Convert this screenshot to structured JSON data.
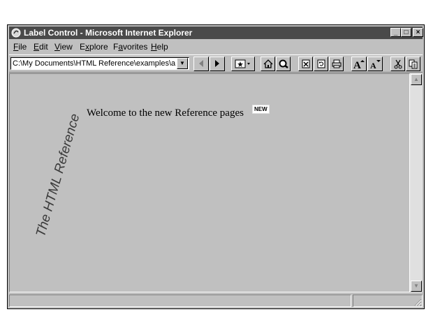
{
  "window": {
    "title": "Label Control - Microsoft Internet Explorer",
    "controls": {
      "minimize": "_",
      "maximize": "□",
      "close": "×"
    }
  },
  "menu": {
    "items": [
      {
        "u": "F",
        "rest": "ile"
      },
      {
        "u": "E",
        "rest": "dit"
      },
      {
        "u": "V",
        "rest": "iew"
      },
      {
        "pre": "E",
        "u": "x",
        "rest": "plore"
      },
      {
        "pre": "F",
        "u": "a",
        "rest": "vorites"
      },
      {
        "u": "H",
        "rest": "elp"
      }
    ]
  },
  "toolbar": {
    "address_value": "C:\\My Documents\\HTML Reference\\examples\\a",
    "icons": [
      "back-icon",
      "forward-icon",
      "favorites-icon",
      "home-icon",
      "search-icon",
      "stop-icon",
      "refresh-icon",
      "print-icon",
      "font-larger-icon",
      "font-smaller-icon",
      "cut-icon",
      "copy-icon"
    ]
  },
  "content": {
    "rotated_label": "The HTML Reference",
    "welcome": "Welcome to the new Reference pages",
    "badge": "NEW"
  },
  "colors": {
    "titlebar": "#4a4a4a",
    "chrome": "#c0c0c0"
  }
}
